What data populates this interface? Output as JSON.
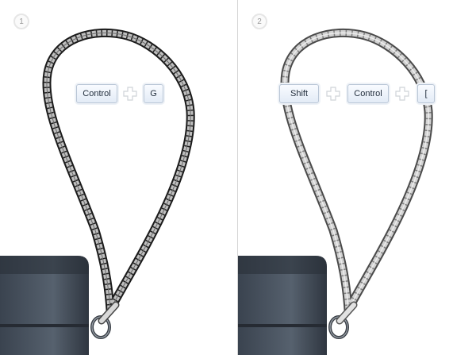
{
  "steps": [
    {
      "number": "1",
      "shortcut": {
        "keys": [
          "Control",
          "G"
        ]
      }
    },
    {
      "number": "2",
      "shortcut": {
        "keys": [
          "Shift",
          "Control",
          "["
        ]
      }
    }
  ]
}
